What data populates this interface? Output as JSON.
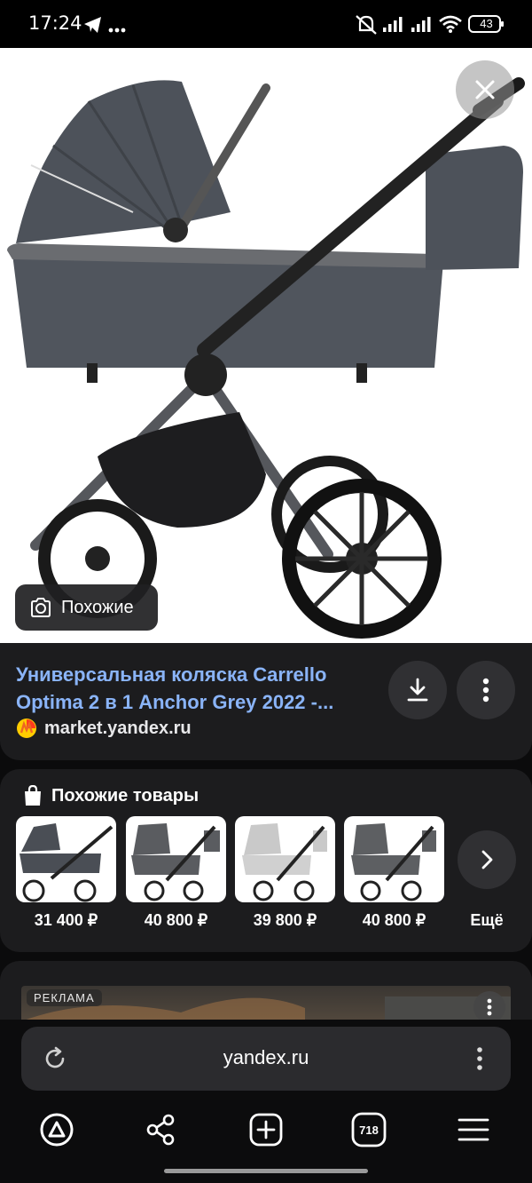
{
  "status_bar": {
    "time": "17:24",
    "battery": "43",
    "icons": [
      "telegram-icon",
      "more-dots-icon",
      "silent-icon",
      "signal-icon",
      "signal-icon",
      "wifi-icon",
      "battery-icon"
    ]
  },
  "viewer": {
    "close_icon": "close-icon",
    "similar_button_label": "Похожие"
  },
  "result": {
    "title_line1": "Универсальная коляска Carrello",
    "title_line2": "Optima 2 в 1 Anchor Grey 2022 -...",
    "source": "market.yandex.ru",
    "download_icon": "download-icon",
    "menu_icon": "more-vertical-icon"
  },
  "similar": {
    "header": "Похожие товары",
    "items": [
      {
        "price": "31 400 ₽",
        "shade": "#4a4e55"
      },
      {
        "price": "40 800 ₽",
        "shade": "#5a5c60"
      },
      {
        "price": "39 800 ₽",
        "shade": "#c9c9c9"
      },
      {
        "price": "40 800 ₽",
        "shade": "#5d5f62"
      }
    ],
    "more_label": "Ещё"
  },
  "ad": {
    "badge": "РЕКЛАМА"
  },
  "browser": {
    "url": "yandex.ru",
    "tabs_count": "718"
  },
  "colors": {
    "link": "#8ab4f8",
    "card": "#1c1c1e",
    "button": "#303033",
    "stroller": "#4d525a"
  }
}
